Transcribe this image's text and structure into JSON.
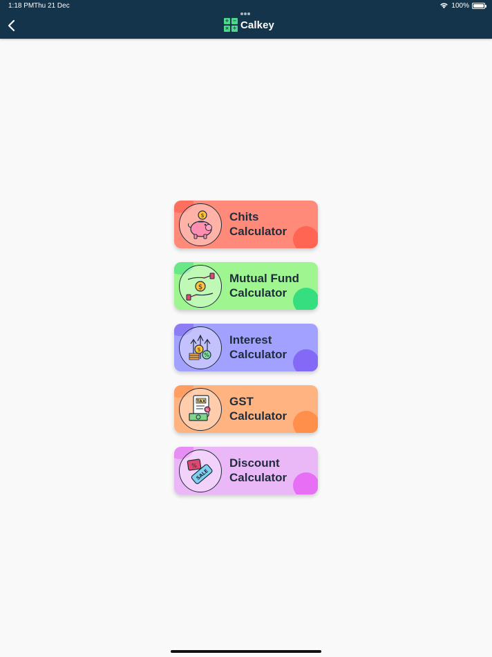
{
  "status_bar": {
    "time": "1:18 PM",
    "date": "Thu 21 Dec",
    "battery": "100%"
  },
  "header": {
    "title": "Calkey",
    "back_icon": "chevron-left-icon",
    "logo_icon": "calculator-grid-icon",
    "logo_glyphs": [
      "+",
      "−",
      "×",
      "÷"
    ],
    "background_color": "#14344b",
    "logo_color": "#4cd98a"
  },
  "menu": {
    "items": [
      {
        "line1": "Chits",
        "line2": "Calculator",
        "icon": "piggy-bank-icon",
        "color": "#ff8a7a"
      },
      {
        "line1": "Mutual Fund",
        "line2": "Calculator",
        "icon": "hands-coin-icon",
        "color": "#9ff58f"
      },
      {
        "line1": "Interest",
        "line2": "Calculator",
        "icon": "coins-growth-icon",
        "color": "#a3a1ff"
      },
      {
        "line1": "GST",
        "line2": "Calculator",
        "icon": "tax-document-icon",
        "color": "#ffb380"
      },
      {
        "line1": "Discount",
        "line2": "Calculator",
        "icon": "sale-tag-icon",
        "color": "#ebb8f7"
      }
    ],
    "icon_text": {
      "tax": "TAX",
      "sale": "SALE"
    }
  }
}
